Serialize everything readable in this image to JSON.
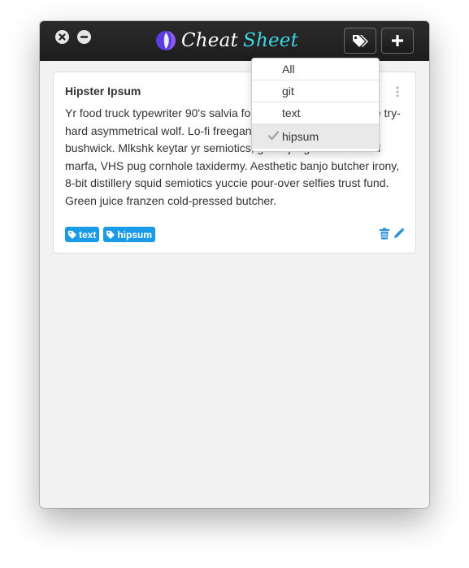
{
  "app": {
    "title_part1": "Cheat",
    "title_part2": "Sheet",
    "accent": "#3ed7e6",
    "tag_color": "#1a9be8"
  },
  "toolbar": {
    "close_icon": "close-icon",
    "minimize_icon": "minimize-icon",
    "tags_icon": "tags-icon",
    "add_icon": "plus-icon"
  },
  "card": {
    "title": "Hipster Ipsum",
    "body": "Yr food truck typewriter 90's salvia forage, fanny pack locavore try-hard asymmetrical wolf. Lo-fi freegan pour-over house bitters bushwick. Mlkshk keytar yr semiotics, gochujang lumbersexual marfa, VHS pug cornhole taxidermy. Aesthetic banjo butcher irony, 8-bit distillery squid semiotics yuccie pour-over selfies trust fund. Green juice franzen cold-pressed butcher.",
    "tags": [
      "text",
      "hipsum"
    ]
  },
  "tag_filter": {
    "options": [
      "All",
      "git",
      "text",
      "hipsum"
    ],
    "selected": "hipsum"
  }
}
